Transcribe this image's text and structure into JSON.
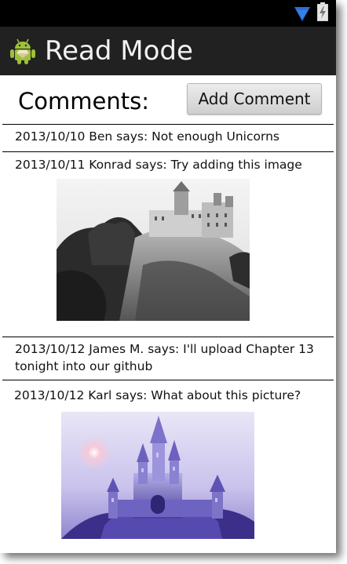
{
  "app": {
    "title": "Read Mode",
    "icon": "android-icon"
  },
  "status_bar": {
    "icons": [
      "wifi-icon",
      "battery-charging-icon"
    ]
  },
  "header": {
    "comments_label": "Comments:",
    "add_comment_label": "Add Comment"
  },
  "comments": [
    {
      "text": "2013/10/10 Ben says: Not enough Unicorns"
    },
    {
      "text": "2013/10/11 Konrad says: Try adding this image",
      "image": "castle-photo"
    },
    {
      "text": "2013/10/12 James M. says: I'll upload Chapter 13 tonight into our github"
    },
    {
      "text": "2013/10/12 Karl says: What about this picture?",
      "image": "fantasy-castle-illustration"
    }
  ],
  "colors": {
    "status_bar": "#000000",
    "action_bar": "#212121",
    "android_green": "#9fc03b",
    "wifi_blue": "#2e6fd8"
  }
}
